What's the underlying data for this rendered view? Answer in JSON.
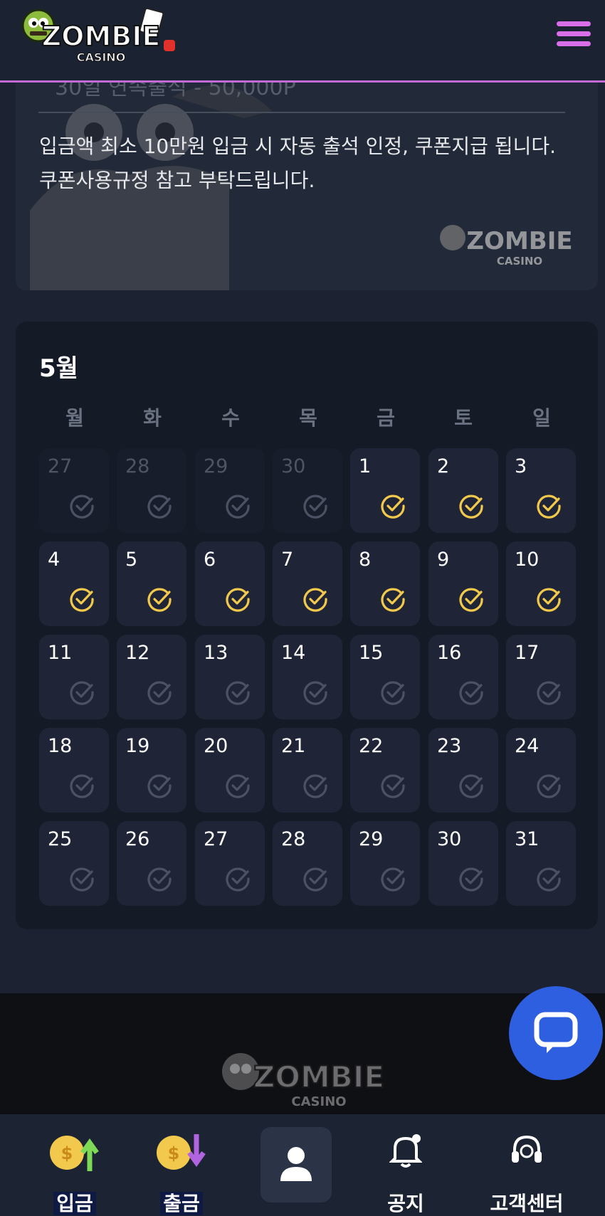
{
  "header": {
    "logo_text": "ZOMBIE",
    "logo_subtext": "CASINO",
    "menu_icon": "hamburger-icon",
    "accent_color": "#d86ee8"
  },
  "info": {
    "faded_line": "30일 연속출석 - 50,000P",
    "notice_line1": "입금액 최소 10만원 입금 시 자동 출석 인정, 쿠폰지급 됩니다.",
    "notice_line2": "쿠폰사용규정 참고 부탁드립니다."
  },
  "calendar": {
    "month_label": "5월",
    "weekdays": [
      "월",
      "화",
      "수",
      "목",
      "금",
      "토",
      "일"
    ],
    "days": [
      {
        "day": "27",
        "muted": true,
        "checked": false
      },
      {
        "day": "28",
        "muted": true,
        "checked": false
      },
      {
        "day": "29",
        "muted": true,
        "checked": false
      },
      {
        "day": "30",
        "muted": true,
        "checked": false
      },
      {
        "day": "1",
        "muted": false,
        "checked": true
      },
      {
        "day": "2",
        "muted": false,
        "checked": true
      },
      {
        "day": "3",
        "muted": false,
        "checked": true
      },
      {
        "day": "4",
        "muted": false,
        "checked": true
      },
      {
        "day": "5",
        "muted": false,
        "checked": true
      },
      {
        "day": "6",
        "muted": false,
        "checked": true
      },
      {
        "day": "7",
        "muted": false,
        "checked": true
      },
      {
        "day": "8",
        "muted": false,
        "checked": true
      },
      {
        "day": "9",
        "muted": false,
        "checked": true
      },
      {
        "day": "10",
        "muted": false,
        "checked": true
      },
      {
        "day": "11",
        "muted": false,
        "checked": false
      },
      {
        "day": "12",
        "muted": false,
        "checked": false
      },
      {
        "day": "13",
        "muted": false,
        "checked": false
      },
      {
        "day": "14",
        "muted": false,
        "checked": false
      },
      {
        "day": "15",
        "muted": false,
        "checked": false
      },
      {
        "day": "16",
        "muted": false,
        "checked": false
      },
      {
        "day": "17",
        "muted": false,
        "checked": false
      },
      {
        "day": "18",
        "muted": false,
        "checked": false
      },
      {
        "day": "19",
        "muted": false,
        "checked": false
      },
      {
        "day": "20",
        "muted": false,
        "checked": false
      },
      {
        "day": "21",
        "muted": false,
        "checked": false
      },
      {
        "day": "22",
        "muted": false,
        "checked": false
      },
      {
        "day": "23",
        "muted": false,
        "checked": false
      },
      {
        "day": "24",
        "muted": false,
        "checked": false
      },
      {
        "day": "25",
        "muted": false,
        "checked": false
      },
      {
        "day": "26",
        "muted": false,
        "checked": false
      },
      {
        "day": "27",
        "muted": false,
        "checked": false
      },
      {
        "day": "28",
        "muted": false,
        "checked": false
      },
      {
        "day": "29",
        "muted": false,
        "checked": false
      },
      {
        "day": "30",
        "muted": false,
        "checked": false
      },
      {
        "day": "31",
        "muted": false,
        "checked": false
      }
    ],
    "checked_color": "#f2c94c",
    "unchecked_color": "#4b5263"
  },
  "nav": {
    "deposit_label": "입금",
    "withdraw_label": "출금",
    "notice_label": "공지",
    "support_label": "고객센터"
  }
}
